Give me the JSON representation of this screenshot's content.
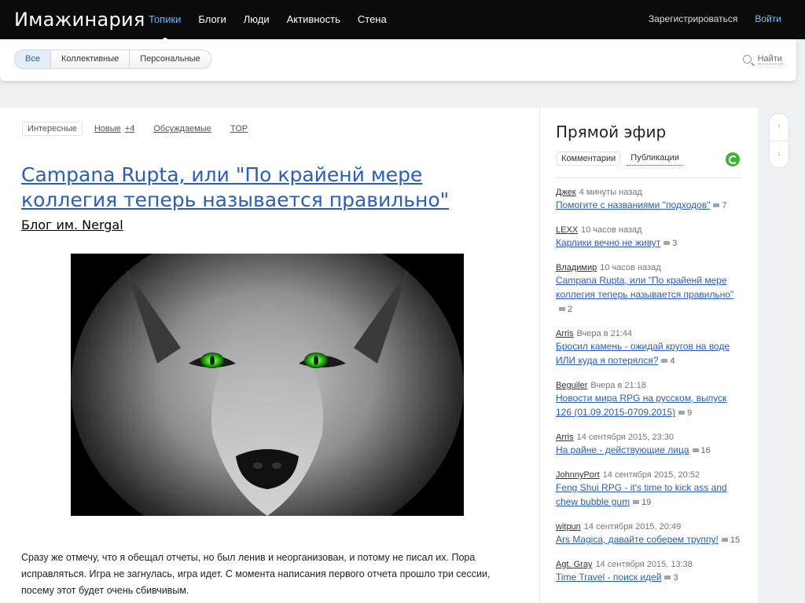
{
  "site": {
    "title": "Имажинария"
  },
  "nav": {
    "items": [
      {
        "label": "Топики",
        "active": true
      },
      {
        "label": "Блоги",
        "active": false
      },
      {
        "label": "Люди",
        "active": false
      },
      {
        "label": "Активность",
        "active": false
      },
      {
        "label": "Стена",
        "active": false
      }
    ],
    "register": "Зарегистрироваться",
    "login": "Войти"
  },
  "subnav": {
    "filters": [
      {
        "label": "Все",
        "active": true
      },
      {
        "label": "Коллективные",
        "active": false
      },
      {
        "label": "Персональные",
        "active": false
      }
    ],
    "search": "Найти"
  },
  "topic_tabs": {
    "interesting": "Интересные",
    "new": "Новые",
    "new_count": "+4",
    "discussed": "Обсуждаемые",
    "top": "TOP"
  },
  "post": {
    "title": "Campana Rupta, или \"По крайенй мере коллегия теперь называется правильно\"",
    "blog": "Блог им. Nergal",
    "image": "wolf-portrait-green-eyes",
    "text": "Сразу же отмечу, что я обещал отчеты, но был ленив и неорганизован, и потому не писал их. Пора исправляться. Игра не загнулась, игра идет. С момента написания первого отчета прошло три сессии, посему этот будет очень сбивчивым."
  },
  "sidebar": {
    "title": "Прямой эфир",
    "tab_comments": "Комментарии",
    "tab_publications": "Публикации",
    "feed": [
      {
        "author": "Джек",
        "time": "4 минуты назад",
        "title": "Помогите с названиями \"подходов\"",
        "comments": "7"
      },
      {
        "author": "LEXX",
        "time": "10 часов назад",
        "title": "Карлики вечно не живут",
        "comments": "3"
      },
      {
        "author": "Владимир",
        "time": "10 часов назад",
        "title": "Campana Rupta, или \"По крайенй мере коллегия теперь называется правильно\"",
        "comments": "2"
      },
      {
        "author": "Arris",
        "time": "Вчера в 21:44",
        "title": "Бросил камень - ожидай кругов на воде ИЛИ куда я потерялся?",
        "comments": "4"
      },
      {
        "author": "Beguiler",
        "time": "Вчера в 21:18",
        "title": "Новости мира RPG на русском, выпуск 126 (01.09.2015-0709.2015)",
        "comments": "9"
      },
      {
        "author": "Arris",
        "time": "14 сентября 2015, 23:30",
        "title": "На райне - действующие лица",
        "comments": "16"
      },
      {
        "author": "JohnnyPort",
        "time": "14 сентября 2015, 20:52",
        "title": "Feng Shui RPG - it's time to kick ass and chew bubble gum",
        "comments": "19"
      },
      {
        "author": "witpun",
        "time": "14 сентября 2015, 20:49",
        "title": "Ars Magica, давайте соберем труппу!",
        "comments": "15"
      },
      {
        "author": "Agt. Gray",
        "time": "14 сентября 2015, 13:38",
        "title": "Time Travel - поиск идей",
        "comments": "3"
      }
    ]
  },
  "scroller": {
    "up": "↑",
    "down": "↓"
  }
}
